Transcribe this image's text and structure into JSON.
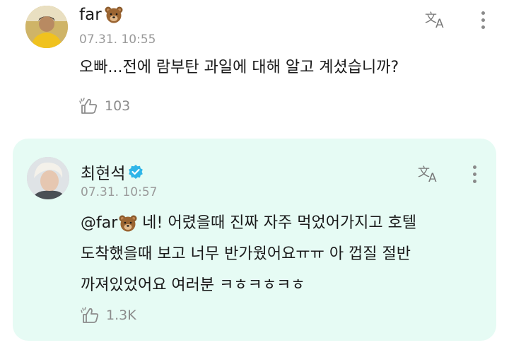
{
  "comments": [
    {
      "author": "far",
      "author_suffix_icon": "bear-face-icon",
      "time": "07.31. 10:55",
      "text": "오빠...전에 람부탄 과일에 대해 알고 계셨습니까?",
      "likes": "103"
    },
    {
      "author": "최현석",
      "verified": true,
      "time": "07.31. 10:57",
      "mention": "@far",
      "mention_icon": "bear-face-icon",
      "text_line1": " 네! 어렸을때 진짜 자주 먹었어가지고 호텔",
      "text_line2": "도착했을때 보고 너무 반가웠어요ㅠㅠ 아 껍질 절반",
      "text_line3": "까져있었어요 여러분 ㅋㅎㅋㅎㅋㅎ",
      "likes": "1.3K"
    }
  ],
  "colors": {
    "reply_background": "#e6fbf4",
    "verified_badge": "#2fb5e8",
    "meta_gray": "#9a9a9a"
  }
}
